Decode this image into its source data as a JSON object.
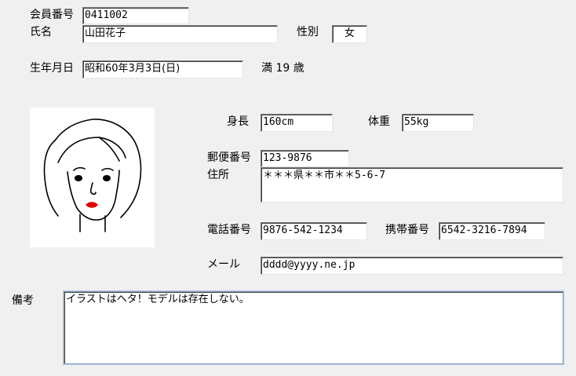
{
  "member": {
    "number_label": "会員番号",
    "number_value": "0411002",
    "name_label": "氏名",
    "name_value": "山田花子",
    "gender_label": "性別",
    "gender_value": "女",
    "birth_label": "生年月日",
    "birth_value": "昭和60年3月3日(日)",
    "age_text": "満 19 歳"
  },
  "body": {
    "height_label": "身長",
    "height_value": "160cm",
    "weight_label": "体重",
    "weight_value": "55kg"
  },
  "address": {
    "postal_label": "郵便番号",
    "postal_value": "123-9876",
    "address_label": "住所",
    "address_value": "＊＊＊県＊＊市＊＊5-6-7"
  },
  "contact": {
    "phone_label": "電話番号",
    "phone_value": "9876-542-1234",
    "mobile_label": "携帯番号",
    "mobile_value": "6542-3216-7894",
    "mail_label": "メール",
    "mail_value": "dddd@yyyy.ne.jp"
  },
  "notes": {
    "label": "備考",
    "value": "イラストはヘタ！モデルは存在しない。"
  },
  "colors": {
    "background": "#f0f0f0",
    "field_background": "#ffffff",
    "lip_color": "#e00000"
  }
}
